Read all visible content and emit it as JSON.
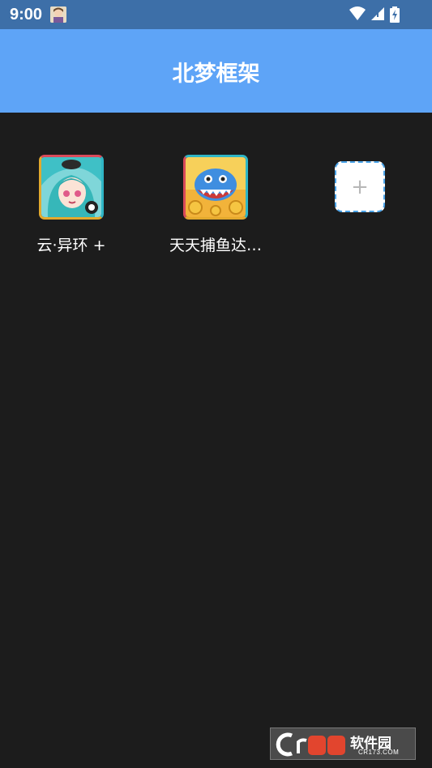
{
  "status_bar": {
    "time": "9:00",
    "icons": [
      "avatar-icon",
      "wifi-icon",
      "signal-icon",
      "battery-icon"
    ]
  },
  "app_bar": {
    "title": "北梦框架",
    "color": "#5ea4f7"
  },
  "apps": [
    {
      "label": "云·异环 +",
      "icon": "anime-girl-icon"
    },
    {
      "label": "天天捕鱼达…",
      "icon": "shark-coin-icon"
    }
  ],
  "add_tile": {
    "symbol": "+"
  },
  "watermark": {
    "brand": "软件园",
    "domain": "CR173.COM"
  },
  "colors": {
    "background": "#1c1c1c",
    "status_bar": "#3d6fa8",
    "accent": "#5ea4f7"
  }
}
